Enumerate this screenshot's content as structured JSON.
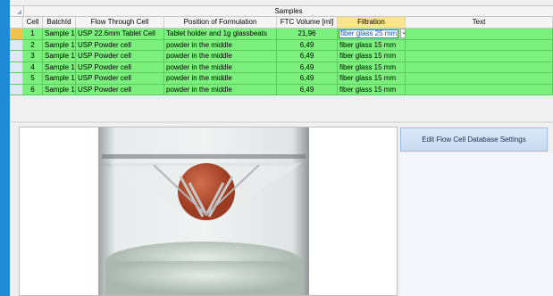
{
  "grid": {
    "group_title": "Samples",
    "columns": [
      "Cell",
      "BatchId",
      "Flow Through Cell",
      "Position of Formulation",
      "FTC Volume [ml]",
      "Filtration",
      "Text"
    ],
    "rows": [
      {
        "cell": "1",
        "batch": "Sample 1",
        "ftc": "USP 22.6mm Tablet Cell",
        "position": "Tablet holder and 1g glassbeats",
        "volume": "21,96",
        "filtration": "fiber glass 25 mm",
        "text": ""
      },
      {
        "cell": "2",
        "batch": "Sample 1",
        "ftc": "USP Powder cell",
        "position": "powder in the middle",
        "volume": "6,49",
        "filtration": "fiber glass 15 mm",
        "text": ""
      },
      {
        "cell": "3",
        "batch": "Sample 1",
        "ftc": "USP Powder cell",
        "position": "powder in the middle",
        "volume": "6,49",
        "filtration": "fiber glass 15 mm",
        "text": ""
      },
      {
        "cell": "4",
        "batch": "Sample 1",
        "ftc": "USP Powder cell",
        "position": "powder in the middle",
        "volume": "6,49",
        "filtration": "fiber glass 15 mm",
        "text": ""
      },
      {
        "cell": "5",
        "batch": "Sample 1",
        "ftc": "USP Powder cell",
        "position": "powder in the middle",
        "volume": "6,49",
        "filtration": "fiber glass 15 mm",
        "text": ""
      },
      {
        "cell": "6",
        "batch": "Sample 1",
        "ftc": "USP Powder cell",
        "position": "powder in the middle",
        "volume": "6,49",
        "filtration": "fiber glass 15 mm",
        "text": ""
      }
    ]
  },
  "edit_button_label": "Edit Flow Cell Database Settings",
  "colors": {
    "row_green": "#7cf07c",
    "selected_header": "#fce58f",
    "window_blue": "#1f8ad6"
  },
  "icons": {
    "dropdown": "chevron-down-icon"
  }
}
